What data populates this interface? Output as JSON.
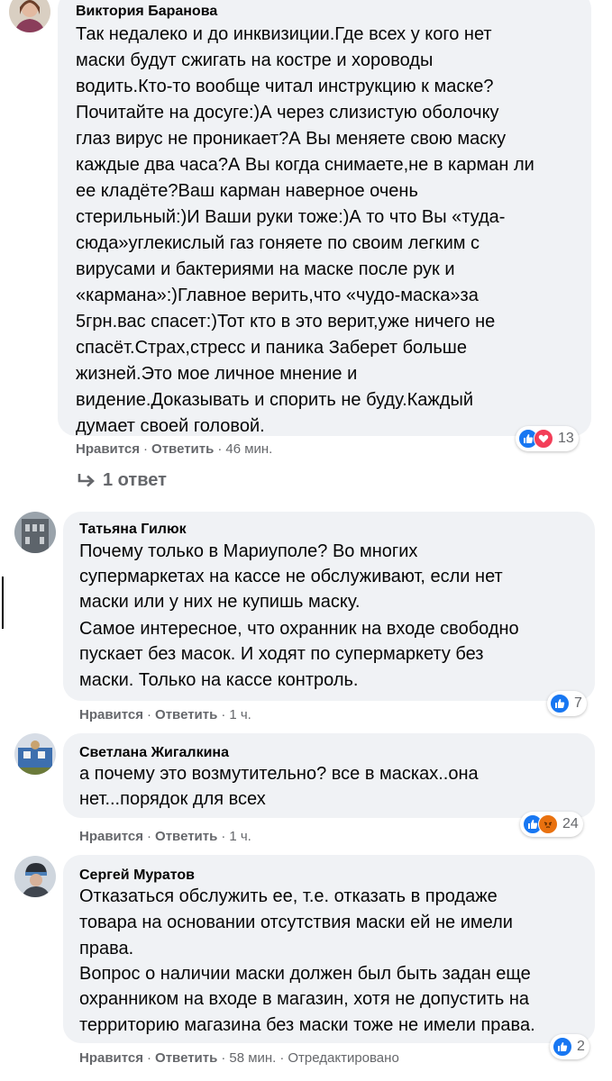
{
  "comments": [
    {
      "author": "Виктория Баранова",
      "lines": [
        "Так недалеко и до инквизиции.Где всех у кого нет",
        "маски будут сжигать на костре и хороводы",
        "водить.Кто-то вообще читал инструкцию к маске?",
        "Почитайте на досуге:)А через слизистую оболочку",
        "глаз вирус не проникает?А Вы меняете свою маску",
        "каждые два часа?А Вы когда снимаете,не в карман ли",
        "ее кладёте?Ваш карман наверное очень",
        "стерильный:)И Ваши руки тоже:)А то что Вы «туда-",
        "сюда»углекислый газ гоняете по своим легким с",
        "вирусами и бактериями на маске после рук и",
        "«кармана»:)Главное верить,что «чудо-маска»за",
        "5грн.вас спасет:)Тот кто в это верит,уже ничего не",
        "спасёт.Страх,стресс и паника Заберет больше",
        "жизней.Это мое личное мнение и",
        "видение.Доказывать и спорить не буду.Каждый",
        "думает своей головой."
      ],
      "like": "Нравится",
      "reply": "Ответить",
      "time": "46 мин.",
      "reaction_count": "13",
      "replies_label": "1 ответ"
    },
    {
      "author": "Татьяна Гилюк",
      "lines": [
        "Почему только в Мариуполе? Во многих",
        "супермаркетах на кассе не обслуживают, если нет",
        "маски или у них не купишь маску.",
        "Самое интересное, что охранник на входе свободно",
        "пускает без масок. И ходят по супермаркету без",
        "маски. Только на кассе контроль."
      ],
      "like": "Нравится",
      "reply": "Ответить",
      "time": "1 ч.",
      "reaction_count": "7"
    },
    {
      "author": "Светлана Жигалкина",
      "lines": [
        "а почему это возмутительно? все в масках..она",
        "нет...порядок для всех"
      ],
      "like": "Нравится",
      "reply": "Ответить",
      "time": "1 ч.",
      "reaction_count": "24"
    },
    {
      "author": "Сергей Муратов",
      "lines": [
        "Отказаться обслужить ее, т.е. отказать в продаже",
        "товара на основании отсутствия маски ей не имели",
        "права.",
        "Вопрос о наличии маски должен был быть задан еще",
        "охранником на входе в магазин, хотя не допустить на",
        "территорию магазина без маски тоже не имели права."
      ],
      "like": "Нравится",
      "reply": "Ответить",
      "time": "58 мин.",
      "edited": "Отредактировано",
      "reaction_count": "2"
    }
  ],
  "icons": {
    "like": "like-icon",
    "love": "love-icon",
    "angry": "angry-icon",
    "reply_arrow": "reply-arrow-icon"
  },
  "colors": {
    "bubble": "#f0f2f5",
    "meta_text": "#65676b",
    "like_blue": "#1877f2",
    "love_red": "#f33e58",
    "angry_orange": "#e9710f"
  }
}
